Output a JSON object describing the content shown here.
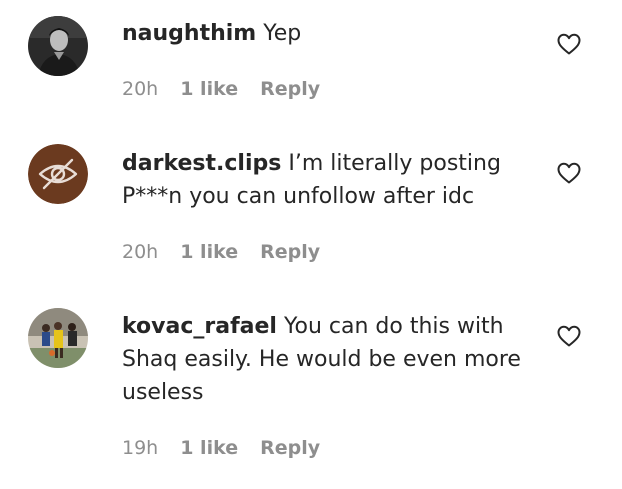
{
  "comments": [
    {
      "username": "naughthim",
      "text": "Yep",
      "time": "20h",
      "likes": "1 like",
      "reply": "Reply"
    },
    {
      "username": "darkest.clips",
      "text": "I’m literally posting P***n you can unfollow after idc",
      "time": "20h",
      "likes": "1 like",
      "reply": "Reply"
    },
    {
      "username": "kovac_rafael",
      "text": "You can do this with Shaq easily. He would be even more useless",
      "time": "19h",
      "likes": "1 like",
      "reply": "Reply"
    }
  ],
  "icons": {
    "like": "heart-outline-icon",
    "hidden_avatar": "eye-slash-icon"
  },
  "colors": {
    "text": "#262626",
    "secondary_text": "#8e8e8e",
    "hidden_avatar_bg": "#6b3a1f"
  }
}
